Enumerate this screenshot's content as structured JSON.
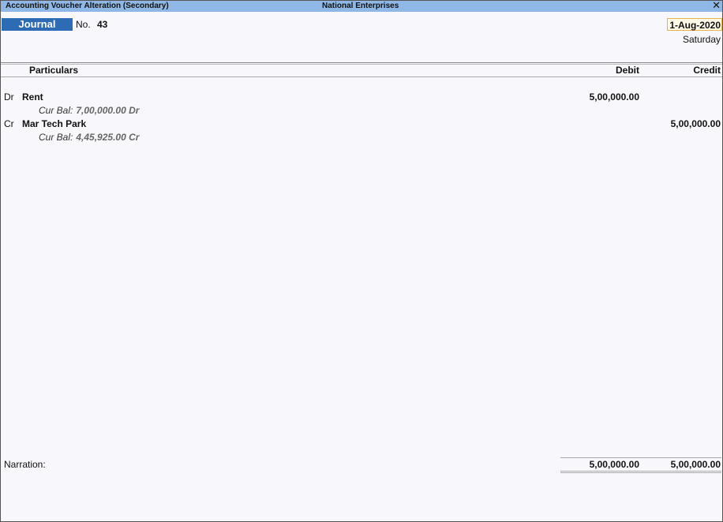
{
  "window": {
    "title": "Accounting Voucher  Alteration  (Secondary)",
    "company": "National Enterprises",
    "close_glyph": "✕"
  },
  "voucher": {
    "type": "Journal",
    "no_label": "No.",
    "number": "43",
    "date": "1-Aug-2020",
    "day": "Saturday"
  },
  "columns": {
    "particulars": "Particulars",
    "debit": "Debit",
    "credit": "Credit"
  },
  "entries": [
    {
      "side": "Dr",
      "ledger": "Rent",
      "debit": "5,00,000.00",
      "credit": "",
      "cur_bal_label": "Cur Bal:",
      "cur_bal_value": "7,00,000.00 Dr"
    },
    {
      "side": "Cr",
      "ledger": "Mar Tech Park",
      "debit": "",
      "credit": "5,00,000.00",
      "cur_bal_label": "Cur Bal:",
      "cur_bal_value": "4,45,925.00 Cr"
    }
  ],
  "footer": {
    "narration_label": "Narration:",
    "total_debit": "5,00,000.00",
    "total_credit": "5,00,000.00"
  }
}
